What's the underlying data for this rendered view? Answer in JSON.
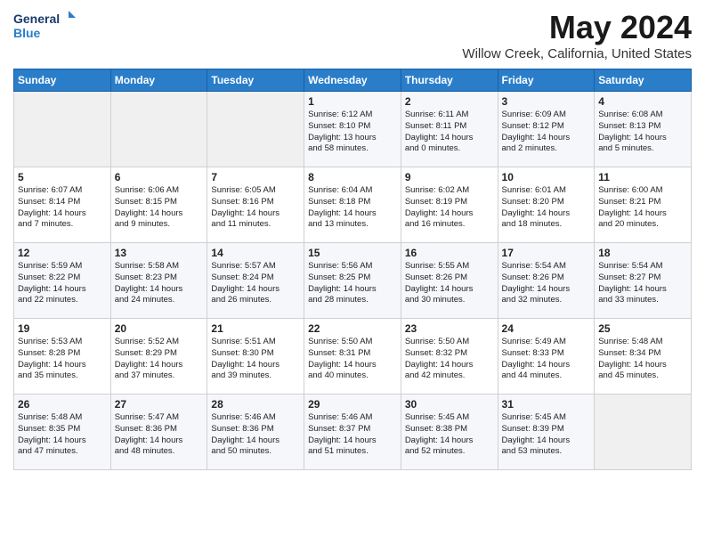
{
  "logo": {
    "line1": "General",
    "line2": "Blue"
  },
  "title": "May 2024",
  "subtitle": "Willow Creek, California, United States",
  "days_of_week": [
    "Sunday",
    "Monday",
    "Tuesday",
    "Wednesday",
    "Thursday",
    "Friday",
    "Saturday"
  ],
  "weeks": [
    [
      {
        "day": "",
        "content": ""
      },
      {
        "day": "",
        "content": ""
      },
      {
        "day": "",
        "content": ""
      },
      {
        "day": "1",
        "content": "Sunrise: 6:12 AM\nSunset: 8:10 PM\nDaylight: 13 hours\nand 58 minutes."
      },
      {
        "day": "2",
        "content": "Sunrise: 6:11 AM\nSunset: 8:11 PM\nDaylight: 14 hours\nand 0 minutes."
      },
      {
        "day": "3",
        "content": "Sunrise: 6:09 AM\nSunset: 8:12 PM\nDaylight: 14 hours\nand 2 minutes."
      },
      {
        "day": "4",
        "content": "Sunrise: 6:08 AM\nSunset: 8:13 PM\nDaylight: 14 hours\nand 5 minutes."
      }
    ],
    [
      {
        "day": "5",
        "content": "Sunrise: 6:07 AM\nSunset: 8:14 PM\nDaylight: 14 hours\nand 7 minutes."
      },
      {
        "day": "6",
        "content": "Sunrise: 6:06 AM\nSunset: 8:15 PM\nDaylight: 14 hours\nand 9 minutes."
      },
      {
        "day": "7",
        "content": "Sunrise: 6:05 AM\nSunset: 8:16 PM\nDaylight: 14 hours\nand 11 minutes."
      },
      {
        "day": "8",
        "content": "Sunrise: 6:04 AM\nSunset: 8:18 PM\nDaylight: 14 hours\nand 13 minutes."
      },
      {
        "day": "9",
        "content": "Sunrise: 6:02 AM\nSunset: 8:19 PM\nDaylight: 14 hours\nand 16 minutes."
      },
      {
        "day": "10",
        "content": "Sunrise: 6:01 AM\nSunset: 8:20 PM\nDaylight: 14 hours\nand 18 minutes."
      },
      {
        "day": "11",
        "content": "Sunrise: 6:00 AM\nSunset: 8:21 PM\nDaylight: 14 hours\nand 20 minutes."
      }
    ],
    [
      {
        "day": "12",
        "content": "Sunrise: 5:59 AM\nSunset: 8:22 PM\nDaylight: 14 hours\nand 22 minutes."
      },
      {
        "day": "13",
        "content": "Sunrise: 5:58 AM\nSunset: 8:23 PM\nDaylight: 14 hours\nand 24 minutes."
      },
      {
        "day": "14",
        "content": "Sunrise: 5:57 AM\nSunset: 8:24 PM\nDaylight: 14 hours\nand 26 minutes."
      },
      {
        "day": "15",
        "content": "Sunrise: 5:56 AM\nSunset: 8:25 PM\nDaylight: 14 hours\nand 28 minutes."
      },
      {
        "day": "16",
        "content": "Sunrise: 5:55 AM\nSunset: 8:26 PM\nDaylight: 14 hours\nand 30 minutes."
      },
      {
        "day": "17",
        "content": "Sunrise: 5:54 AM\nSunset: 8:26 PM\nDaylight: 14 hours\nand 32 minutes."
      },
      {
        "day": "18",
        "content": "Sunrise: 5:54 AM\nSunset: 8:27 PM\nDaylight: 14 hours\nand 33 minutes."
      }
    ],
    [
      {
        "day": "19",
        "content": "Sunrise: 5:53 AM\nSunset: 8:28 PM\nDaylight: 14 hours\nand 35 minutes."
      },
      {
        "day": "20",
        "content": "Sunrise: 5:52 AM\nSunset: 8:29 PM\nDaylight: 14 hours\nand 37 minutes."
      },
      {
        "day": "21",
        "content": "Sunrise: 5:51 AM\nSunset: 8:30 PM\nDaylight: 14 hours\nand 39 minutes."
      },
      {
        "day": "22",
        "content": "Sunrise: 5:50 AM\nSunset: 8:31 PM\nDaylight: 14 hours\nand 40 minutes."
      },
      {
        "day": "23",
        "content": "Sunrise: 5:50 AM\nSunset: 8:32 PM\nDaylight: 14 hours\nand 42 minutes."
      },
      {
        "day": "24",
        "content": "Sunrise: 5:49 AM\nSunset: 8:33 PM\nDaylight: 14 hours\nand 44 minutes."
      },
      {
        "day": "25",
        "content": "Sunrise: 5:48 AM\nSunset: 8:34 PM\nDaylight: 14 hours\nand 45 minutes."
      }
    ],
    [
      {
        "day": "26",
        "content": "Sunrise: 5:48 AM\nSunset: 8:35 PM\nDaylight: 14 hours\nand 47 minutes."
      },
      {
        "day": "27",
        "content": "Sunrise: 5:47 AM\nSunset: 8:36 PM\nDaylight: 14 hours\nand 48 minutes."
      },
      {
        "day": "28",
        "content": "Sunrise: 5:46 AM\nSunset: 8:36 PM\nDaylight: 14 hours\nand 50 minutes."
      },
      {
        "day": "29",
        "content": "Sunrise: 5:46 AM\nSunset: 8:37 PM\nDaylight: 14 hours\nand 51 minutes."
      },
      {
        "day": "30",
        "content": "Sunrise: 5:45 AM\nSunset: 8:38 PM\nDaylight: 14 hours\nand 52 minutes."
      },
      {
        "day": "31",
        "content": "Sunrise: 5:45 AM\nSunset: 8:39 PM\nDaylight: 14 hours\nand 53 minutes."
      },
      {
        "day": "",
        "content": ""
      }
    ]
  ]
}
